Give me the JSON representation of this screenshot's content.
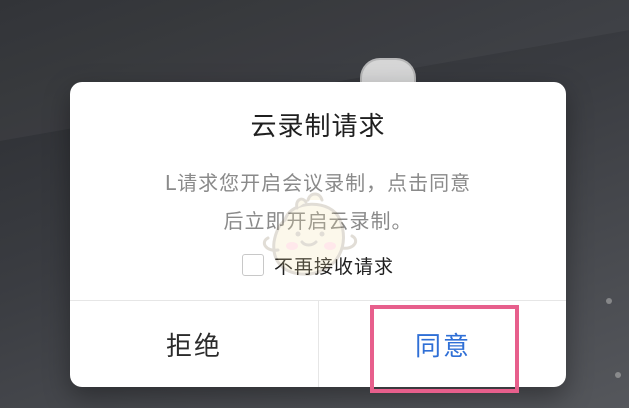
{
  "dialog": {
    "title": "云录制请求",
    "message_line1": "L请求您开启会议录制，点击同意",
    "message_line2": "后立即开启云录制。",
    "checkbox_label": "不再接收请求",
    "checkbox_checked": false,
    "buttons": {
      "reject": "拒绝",
      "agree": "同意"
    }
  },
  "colors": {
    "accent": "#2f6fd6",
    "highlight": "#e75f8c"
  }
}
